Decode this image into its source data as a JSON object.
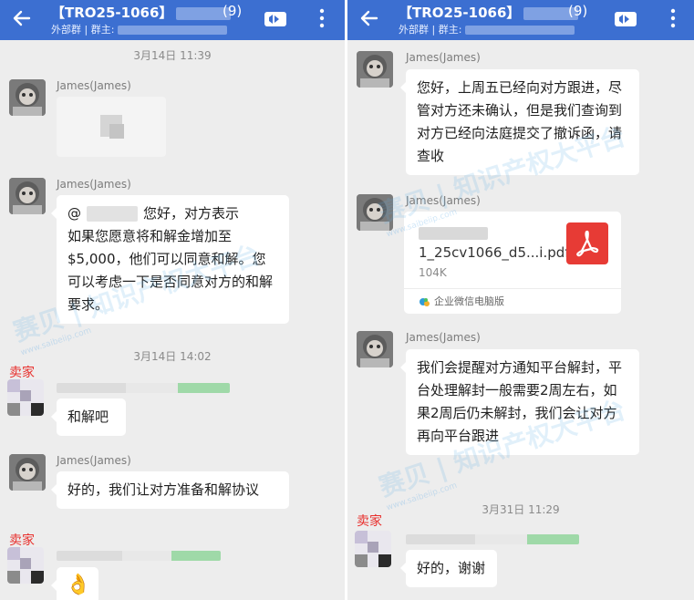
{
  "left": {
    "header": {
      "title": "【TRO25-1066】",
      "count": "(9)",
      "sub_label": "外部群 | 群主:"
    },
    "messages": [
      {
        "timestamp": "3月14日  11:39"
      },
      {
        "sender": "James(James)"
      },
      {
        "sender": "James(James)",
        "prefix": "@",
        "text_first": "您好，对方表示",
        "text_rest": "如果您愿意将和解金增加至$5,000，他们可以同意和解。您可以考虑一下是否同意对方的和解要求。"
      },
      {
        "timestamp": "3月14日  14:02"
      },
      {
        "sender_tag": "卖家",
        "text": "和解吧"
      },
      {
        "sender": "James(James)",
        "text": "好的，我们让对方准备和解协议"
      },
      {
        "sender_tag": "卖家",
        "emoji": "👌"
      }
    ]
  },
  "right": {
    "header": {
      "title": "【TRO25-1066】",
      "count": "(9)",
      "sub_label": "外部群 | 群主:"
    },
    "messages": [
      {
        "sender": "James(James)",
        "text": "您好，上周五已经向对方跟进，尽管对方还未确认，但是我们查询到对方已经向法庭提交了撤诉函，请查收"
      },
      {
        "sender": "James(James)",
        "file": {
          "name": "1_25cv1066_d5...i.pdf",
          "size": "104K",
          "source": "企业微信电脑版"
        }
      },
      {
        "sender": "James(James)",
        "text": "我们会提醒对方通知平台解封，平台处理解封一般需要2周左右，如果2周后仍未解封，我们会让对方再向平台跟进"
      },
      {
        "timestamp": "3月31日  11:29"
      },
      {
        "sender_tag": "卖家",
        "text": "好的，谢谢"
      }
    ]
  },
  "watermark": {
    "brand": "赛贝",
    "slogan": "知识产权大平台",
    "url": "www.saibeiip.com"
  },
  "colors": {
    "header": "#3c6fd1",
    "background": "#ededed",
    "seller_tag": "#e8302d",
    "pdf_red": "#e73b35"
  },
  "icons": [
    "back-arrow-icon",
    "video-call-icon",
    "more-vertical-icon",
    "pdf-icon",
    "wecom-icon",
    "ok-hand-emoji"
  ]
}
